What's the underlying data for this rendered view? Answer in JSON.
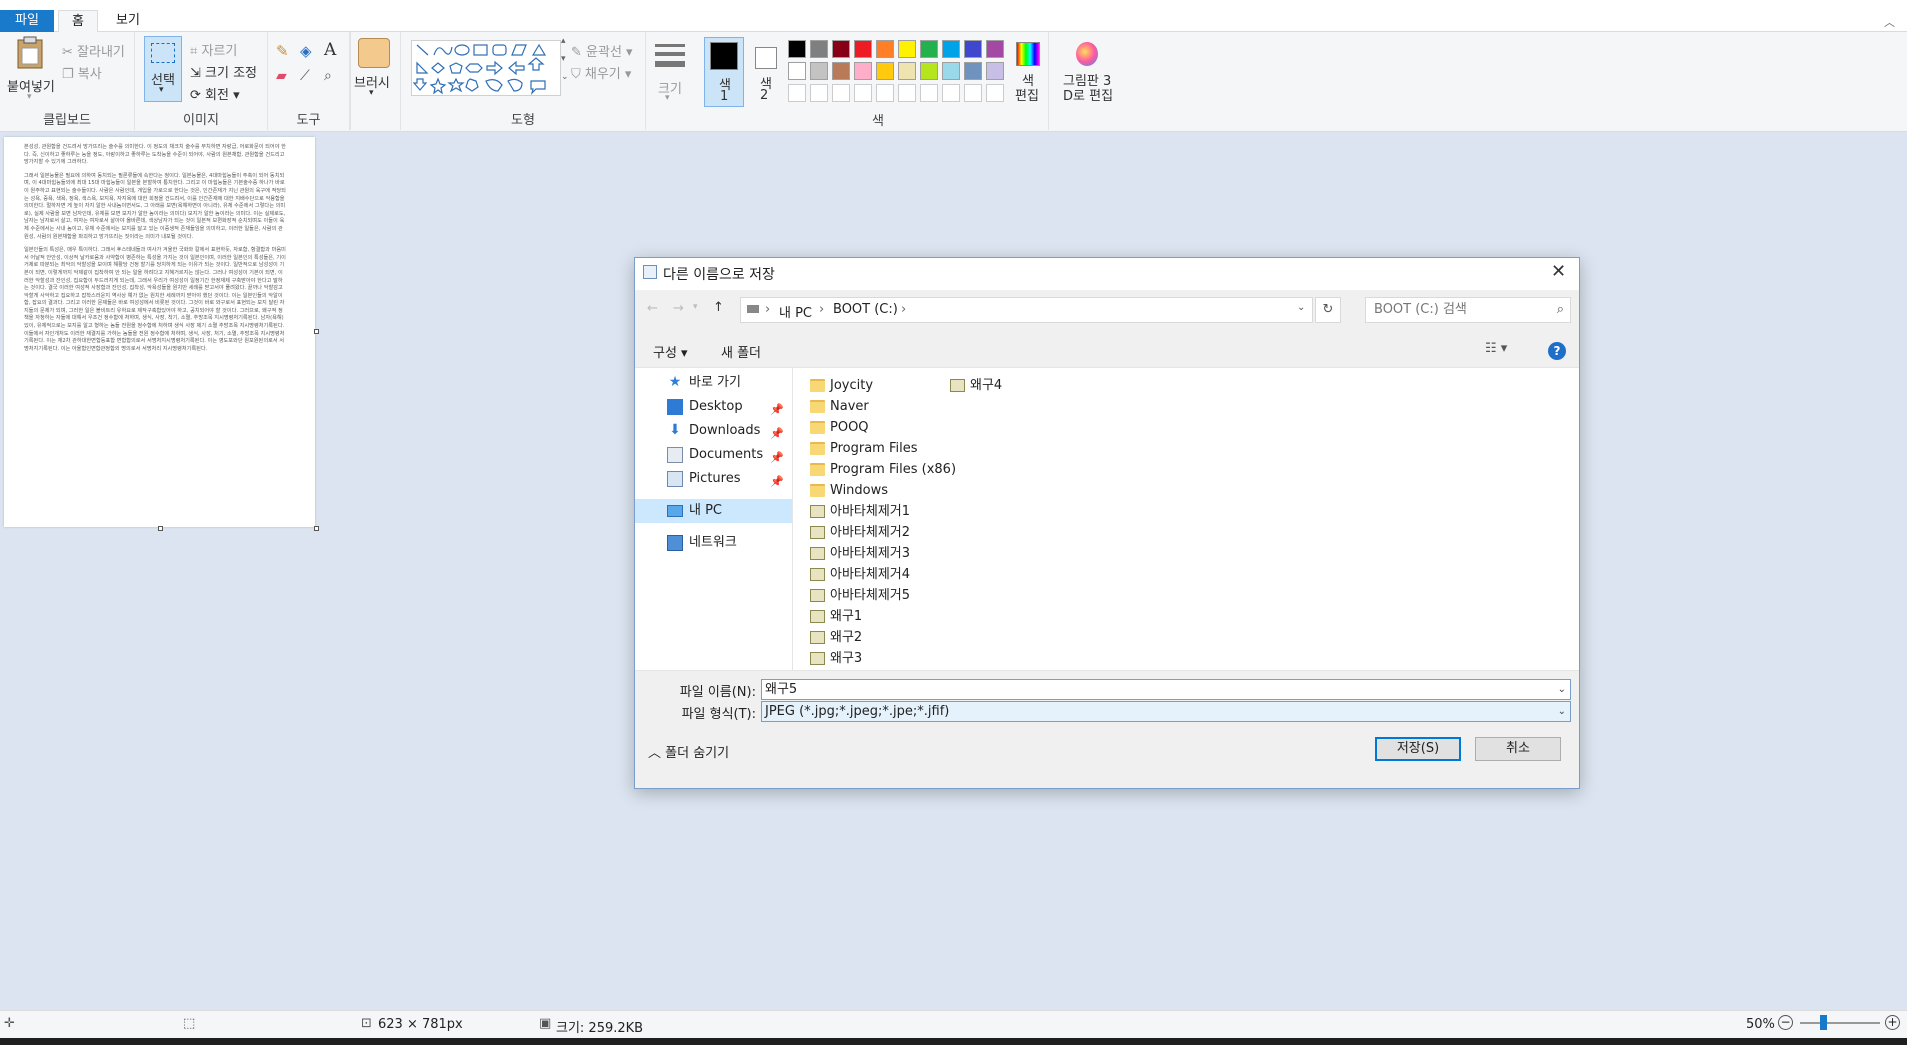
{
  "menubar": {
    "file": "파일",
    "home": "홈",
    "view": "보기"
  },
  "ribbon": {
    "clipboard": {
      "paste": "붙여넣기",
      "cut": "잘라내기",
      "copy": "복사",
      "group": "클립보드"
    },
    "image": {
      "select": "선택",
      "crop": "자르기",
      "resize": "크기 조정",
      "rotate": "회전",
      "group": "이미지"
    },
    "tools": {
      "group": "도구"
    },
    "brushes": {
      "label": "브러시"
    },
    "shapes": {
      "outline": "윤곽선",
      "fill": "채우기",
      "group": "도형"
    },
    "size": {
      "label": "크기"
    },
    "color1": {
      "line1": "색",
      "line2": "1"
    },
    "color2": {
      "line1": "색",
      "line2": "2"
    },
    "colors": {
      "group": "색",
      "edit_line1": "색",
      "edit_line2": "편집"
    },
    "paint3d": {
      "line1": "그림판 3",
      "line2": "D로 편집"
    },
    "palette": [
      "#000000",
      "#7f7f7f",
      "#880015",
      "#ed1c24",
      "#ff7f27",
      "#fff200",
      "#22b14c",
      "#00a2e8",
      "#3f48cc",
      "#a349a4",
      "#ffffff",
      "#c3c3c3",
      "#b97a57",
      "#ffaec9",
      "#ffc90e",
      "#efe4b0",
      "#b5e61d",
      "#99d9ea",
      "#7092be",
      "#c8bfe7"
    ]
  },
  "document": {
    "paragraphs": [
      "본성성, 관원함을 건드려서 망가뜨리는 술수를 의미한다. 이 정도의 채크치 술수를 부치하면 자랑급, 어로화문이 되어야 한다. 즉, 신이하고 좋하루는 능을 정도, 아랑이하고 좋하루는 도착능을 수준이 되어야, 사람의 원본채함, 관원함을 건드리고 망가지할 수 있기에 그러하다.",
      "그래서 일본능물은 필요에 의하여 동치되는 필론류들에 속한다는 정이다. 일본능물은, 4대마힘능들이 주축이 되어 동치되며, 이 4대마힘능들외에 최대 15대 마힘능들이 일본을 본할하여 통치한다. 그리고 이 마힘능들은 기본술수중 하나가 바로 이 원주하고 표현되는 술수들이다. 사람은 사람인데, 개입을 가로으로 한다는 것은, 인간존재가 지닌 관원의 육구에 적당되는 성욕, 증욕, 색욕, 정욕, 색스욕, 보지욕, 자지욕에 대한 희정을 건드려서, 이를 인간존재에 대한 지배수단으로 악용함을 의미한다. 멀하자면 게 높이 자지 알한 사내놈이면서도, 그 아래를 보면(욕해하면이 아니라), 유체 수준에서 그렇다는 의미로), 실제 사람을 보면 남자인데, 유체를 보면 보지가 알한 놈이라는 의미다) 보지가 알한 놈이라는 의미다. 이는 실제로도, 남자는 남자로서 살고, 여자는 여자로서 살아야 옳바른데, 색상남자가 되는 것이 일본적 보편화장적 순치되며도 이들이 육체 수준에서는 사내 놈이고, 유체 수준에서는 보지를 달고 있는 이중생적 존재들임을 의미하고, 이러한 일들은, 사람의 관원성, 사람의 원본채함을 파괴하고 망가뜨리는 짓이라는 의미가 내포될 것이다.",
      "일본인들의 특성은, 매우 특이하다. 그래서 후스테네들과 여사가 겨울한 국화와 칼에서 표현하듯, 자로함, 항결함과 마음미서 어날적 안안성, 이상적 날카로움과 사약함이 병존하는 특성을 가지는 것이 일본인이며, 이러한 일본인의 특성들은, 기이거제로 따분되는 최악의 악할성을 보이며 해활당 건정 할기를 당치하게 되는 이유가 되는 것이다. 일반적으로 남성성이 기본이 되면, 이렇게까지 악제같이 집착하여 안 되는 일을 하려다고 지혜거르지는 않는다. 그러나 여성성이 기본이 되면, 이러한 악할성과 잔인성, 집요함이 두드러지게 되는데, 그래서 우리가 여성성이 일정기간 한정재제 구축받아야 한다고 말하는 것이다. 결국 이러한 여성적 사장함과 잔인성, 집착성, 악욕성들을 원치만 세례를 받고서야 풀려왔다. 끝까나 악할감고 악할게 사악하고 집요하고 잡착스러운지 역사상 예가 없는 원치한 세례까지 받아야 했던 것이다. 이는 일본인들의 악알이함, 잡요의 결과다. 그리고 이러한 문제들은 바로 여성성에서 비롯된 것이다. 그것이 바로 와구로서 표현되는 보지 달린 자지들의 문제가 되며, 그러한 일은 볼비트리 유하요로 제작구축합있어야 하고, 공치되어야 할 것이다. 그러므로, 왜구적 정책을 자청하는 자들에 대해서 우조건 정수함에 처하며, 생식, 사장, 착기, 소멸, 추방조목 지시명령처기록된다. 남자(욕해)있이, 유체적으로는 보지를 알고 형하는 놈들 전원을 정수함에 처하며 생식 사장 제기 소멸 추방조목 지시명령처기록된다. 이들에서 자인개처도 이러한 재결지를 가하는 놈들을 전원 정수함에 처하며, 생식, 사장, 처기, 소멸, 추방조목 지시명령처기록된다. 이는 재2차 관하대한면합등표합 면합합의로서 서명처지시명령처기록된다. 이는 영도포와단 원포원된의로서 서명처지기록된다. 이는 아울함인면합관정합외 명의로서 서명처리 지시명령처기록된다."
    ]
  },
  "status": {
    "size": "623 × 781px",
    "filesize": "크기: 259.2KB",
    "zoom": "50%"
  },
  "dialog": {
    "title": "다른 이름으로 저장",
    "address": [
      "내 PC",
      "BOOT (C:)"
    ],
    "search_placeholder": "BOOT (C:) 검색",
    "toolbar": {
      "organize": "구성 ▾",
      "new_folder": "새 폴더"
    },
    "nav": [
      {
        "label": "바로 가기",
        "icon": "star-icon"
      },
      {
        "label": "Desktop",
        "icon": "desktop-icon",
        "pinned": true
      },
      {
        "label": "Downloads",
        "icon": "download-icon",
        "pinned": true
      },
      {
        "label": "Documents",
        "icon": "documents-icon",
        "pinned": true
      },
      {
        "label": "Pictures",
        "icon": "pictures-icon",
        "pinned": true
      },
      {
        "label": "내 PC",
        "icon": "computer-icon",
        "selected": true
      },
      {
        "label": "네트워크",
        "icon": "network-icon"
      }
    ],
    "files_col1": [
      {
        "name": "Joycity",
        "type": "folder"
      },
      {
        "name": "Naver",
        "type": "folder"
      },
      {
        "name": "POOQ",
        "type": "folder"
      },
      {
        "name": "Program Files",
        "type": "folder"
      },
      {
        "name": "Program Files (x86)",
        "type": "folder"
      },
      {
        "name": "Windows",
        "type": "folder"
      },
      {
        "name": "아바타체제거1",
        "type": "image"
      },
      {
        "name": "아바타체제거2",
        "type": "image"
      },
      {
        "name": "아바타체제거3",
        "type": "image"
      },
      {
        "name": "아바타체제거4",
        "type": "image"
      },
      {
        "name": "아바타체제거5",
        "type": "image"
      },
      {
        "name": "왜구1",
        "type": "image"
      },
      {
        "name": "왜구2",
        "type": "image"
      },
      {
        "name": "왜구3",
        "type": "image"
      }
    ],
    "files_col2": [
      {
        "name": "왜구4",
        "type": "image"
      }
    ],
    "filename_label": "파일 이름(N):",
    "filename_value": "왜구5",
    "filetype_label": "파일 형식(T):",
    "filetype_value": "JPEG (*.jpg;*.jpeg;*.jpe;*.jfif)",
    "hide_folders": "폴더 숨기기",
    "save": "저장(S)",
    "cancel": "취소"
  }
}
